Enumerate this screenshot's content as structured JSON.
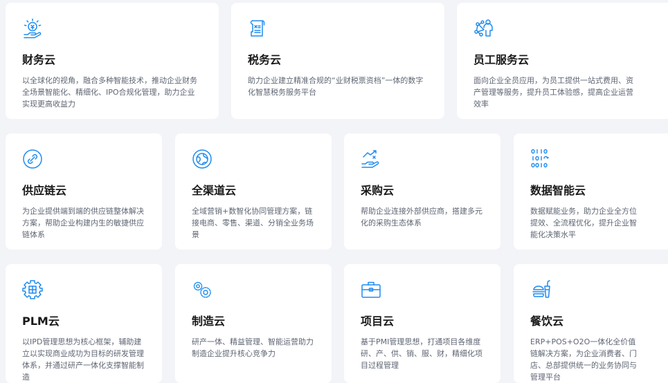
{
  "accent_color": "#1e8cf0",
  "cards": [
    {
      "title": "财务云",
      "icon": "finance-icon",
      "desc": "以全球化的视角，融合多种智能技术，推动企业财务全场景智能化、精细化、IPO合规化管理，助力企业实现更高收益力"
    },
    {
      "title": "税务云",
      "icon": "tax-receipt-icon",
      "desc": "助力企业建立精准合规的“业财税票资档”一体的数字化智慧税务服务平台"
    },
    {
      "title": "员工服务云",
      "icon": "employee-network-icon",
      "desc": "面向企业全员应用，为员工提供一站式费用、资产管理等服务，提升员工体验感，提高企业运营效率"
    },
    {
      "title": "供应链云",
      "icon": "chain-link-icon",
      "desc": "为企业提供端到端的供应链整体解决方案，帮助企业构建内生的敏捷供应链体系"
    },
    {
      "title": "全渠道云",
      "icon": "globe-icon",
      "desc": "全域营销+数智化协同管理方案，链接电商、零售、渠道、分销全业务场景"
    },
    {
      "title": "采购云",
      "icon": "procurement-hand-icon",
      "desc": "帮助企业连接外部供应商，搭建多元化的采购生态体系"
    },
    {
      "title": "数据智能云",
      "icon": "binary-data-icon",
      "desc": "数据赋能业务，助力企业全方位提效、全流程优化，提升企业智能化决策水平"
    },
    {
      "title": "PLM云",
      "icon": "gear-shield-icon",
      "desc": "以IPD管理思想为核心框架，辅助建立以实现商业成功为目标的研发管理体系，并通过研产一体化支撑智能制造"
    },
    {
      "title": "制造云",
      "icon": "gears-icon",
      "desc": "研产一体、精益管理、智能运营助力制造企业提升核心竞争力"
    },
    {
      "title": "项目云",
      "icon": "briefcase-icon",
      "desc": "基于PMI管理思想，打通项目各维度研、产、供、销、服、财，精细化项目过程管理"
    },
    {
      "title": "餐饮云",
      "icon": "food-drink-icon",
      "desc": "ERP+POS+O2O一体化全价值链解决方案，为企业消费者、门店、总部提供统一的业务协同与管理平台"
    }
  ]
}
